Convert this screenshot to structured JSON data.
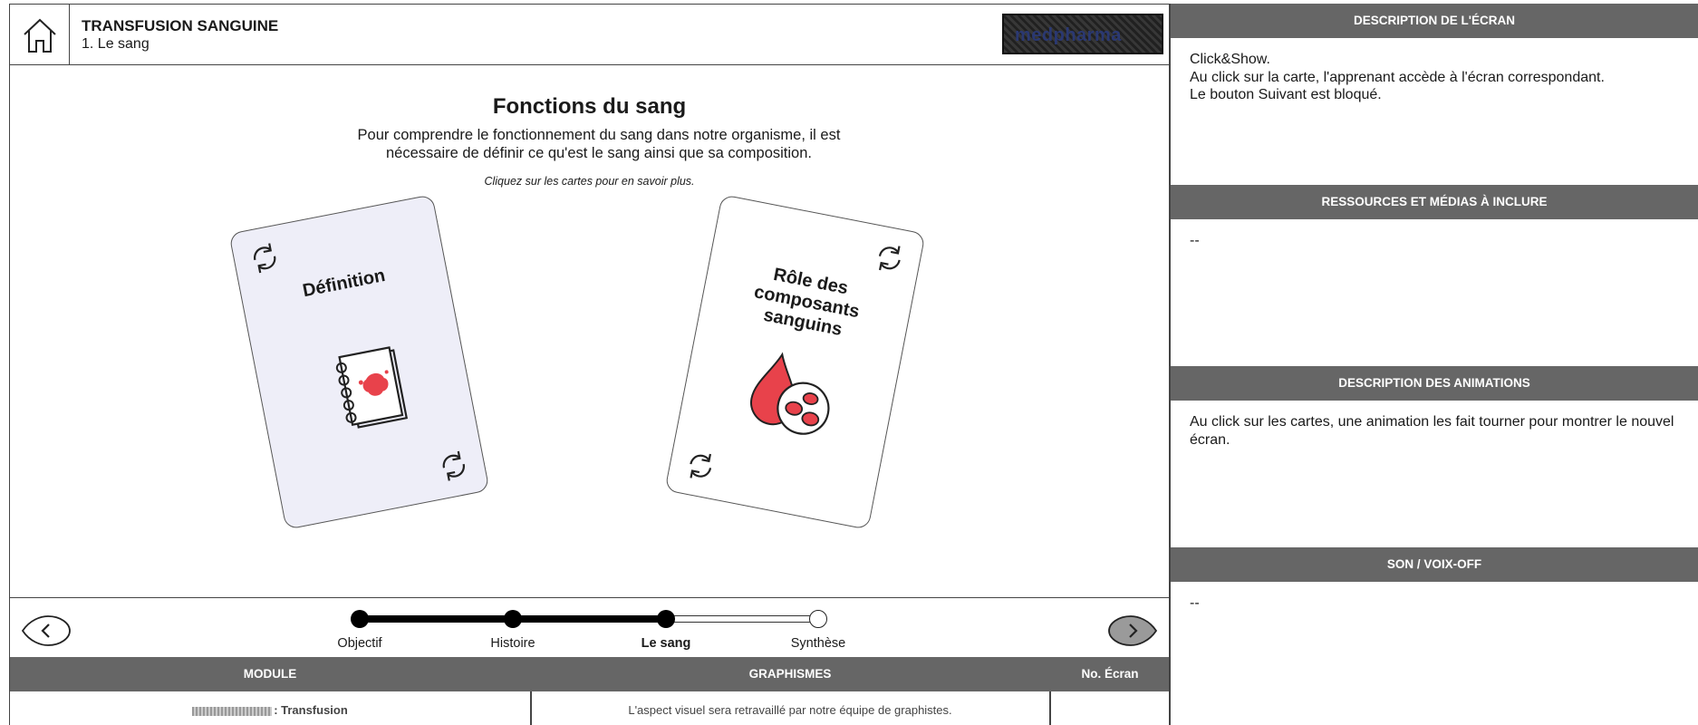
{
  "header": {
    "title": "TRANSFUSION SANGUINE",
    "subtitle": "1. Le sang",
    "logo_text": "medpharma"
  },
  "content": {
    "title": "Fonctions du sang",
    "intro": "Pour comprendre le fonctionnement du sang dans notre organisme, il est nécessaire de définir ce qu'est le sang ainsi que sa composition.",
    "hint": "Cliquez sur les cartes pour en savoir plus."
  },
  "cards": [
    {
      "title": "Définition",
      "icon": "notebook-blood-icon"
    },
    {
      "title": "Rôle des composants sanguins",
      "icon": "blood-drop-cells-icon"
    }
  ],
  "progress": {
    "steps": [
      "Objectif",
      "Histoire",
      "Le sang",
      "Synthèse"
    ],
    "current_step": "Le sang",
    "completed_fraction": 0.67
  },
  "footer": {
    "module_header": "MODULE",
    "graphics_header": "GRAPHISMES",
    "screen_no_header": "No. Écran",
    "module_value": ": Transfusion",
    "graphics_value": "L'aspect visuel sera retravaillé par notre équipe de graphistes.",
    "screen_no_value": ""
  },
  "panel": {
    "sections": [
      {
        "title": "DESCRIPTION DE L'ÉCRAN",
        "body": "Click&Show.\nAu click sur la carte, l'apprenant accède à l'écran correspondant.\nLe bouton Suivant est bloqué."
      },
      {
        "title": "RESSOURCES ET MÉDIAS À INCLURE",
        "body": "--"
      },
      {
        "title": "DESCRIPTION DES ANIMATIONS",
        "body": "Au click sur les cartes, une animation les fait tourner pour montrer le nouvel écran."
      },
      {
        "title": "SON / VOIX-OFF",
        "body": "--"
      }
    ]
  },
  "colors": {
    "header_gray": "#666666",
    "blood_red": "#e8424b",
    "card_lavender": "#eeeef8",
    "next_button_gray": "#9a9a9a"
  }
}
